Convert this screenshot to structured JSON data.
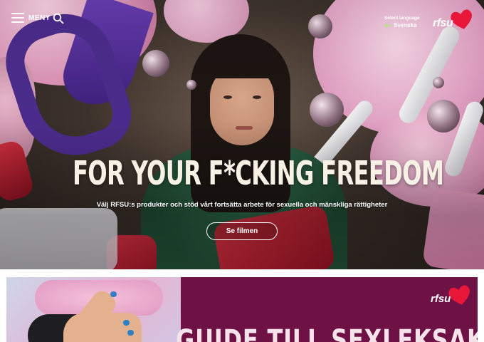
{
  "header": {
    "menu_label": "MENY",
    "language_caption": "Select language",
    "language_value": "Svenska",
    "logo_text": "rfsu"
  },
  "hero": {
    "headline": "FOR YOUR F*CKING FREEDOM",
    "subline": "Välj RFSU:s produkter och stöd vårt fortsätta arbete för sexuella och mänskliga rättigheter",
    "cta_label": "Se filmen"
  },
  "banner": {
    "title": "GUIDE TILL SEXLEKSAKER",
    "logo_text": "rfsu",
    "background": "#6e1145"
  },
  "colors": {
    "heart": "#e8173a",
    "headline_text": "#f7f1e6"
  },
  "icons": {
    "menu": "hamburger-icon",
    "search": "search-icon",
    "language": "arrow-left-icon",
    "logo": "heart-icon"
  }
}
